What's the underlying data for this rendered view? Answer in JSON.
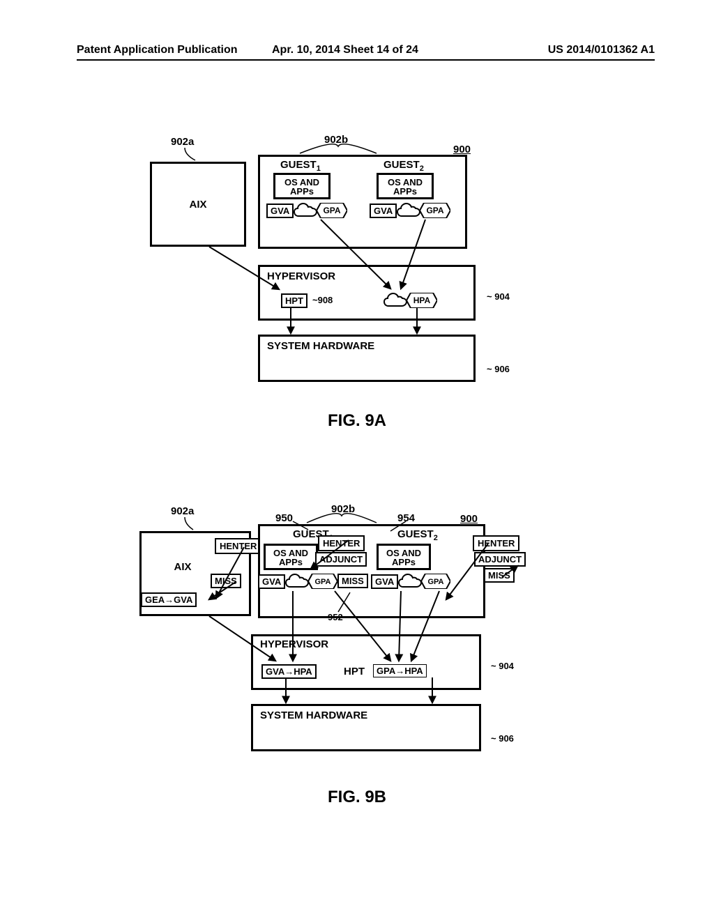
{
  "header": {
    "left": "Patent Application Publication",
    "center": "Apr. 10, 2014   Sheet 14 of 24",
    "right": "US 2014/0101362 A1"
  },
  "fig9a": {
    "caption": "FIG. 9A",
    "ref_902a": "902a",
    "ref_902b": "902b",
    "ref_900": "900",
    "ref_908": "908",
    "ref_904": "904",
    "ref_906": "906",
    "aix": "AIX",
    "guest1": "GUEST",
    "guest2": "GUEST",
    "osapps": "OS AND",
    "osapps2": "APPs",
    "gva": "GVA",
    "gpa": "GPA",
    "hypervisor": "HYPERVISOR",
    "hpt": "HPT",
    "hpa": "HPA",
    "syshw": "SYSTEM HARDWARE"
  },
  "fig9b": {
    "caption": "FIG. 9B",
    "ref_902a": "902a",
    "ref_902b": "902b",
    "ref_900": "900",
    "ref_950": "950",
    "ref_954": "954",
    "ref_952": "952",
    "ref_904": "904",
    "ref_906": "906",
    "aix": "AIX",
    "gea_gva": "GEA→GVA",
    "miss": "MISS",
    "henter": "HENTER",
    "adjunct": "ADJUNCT",
    "guest1": "GUEST",
    "guest2": "GUEST",
    "osapps": "OS AND",
    "osapps2": "APPs",
    "gva": "GVA",
    "gpa": "GPA",
    "hypervisor": "HYPERVISOR",
    "gva_hpa": "GVA→HPA",
    "hpt": "HPT",
    "gpa_hpa": "GPA→HPA",
    "syshw": "SYSTEM HARDWARE"
  }
}
